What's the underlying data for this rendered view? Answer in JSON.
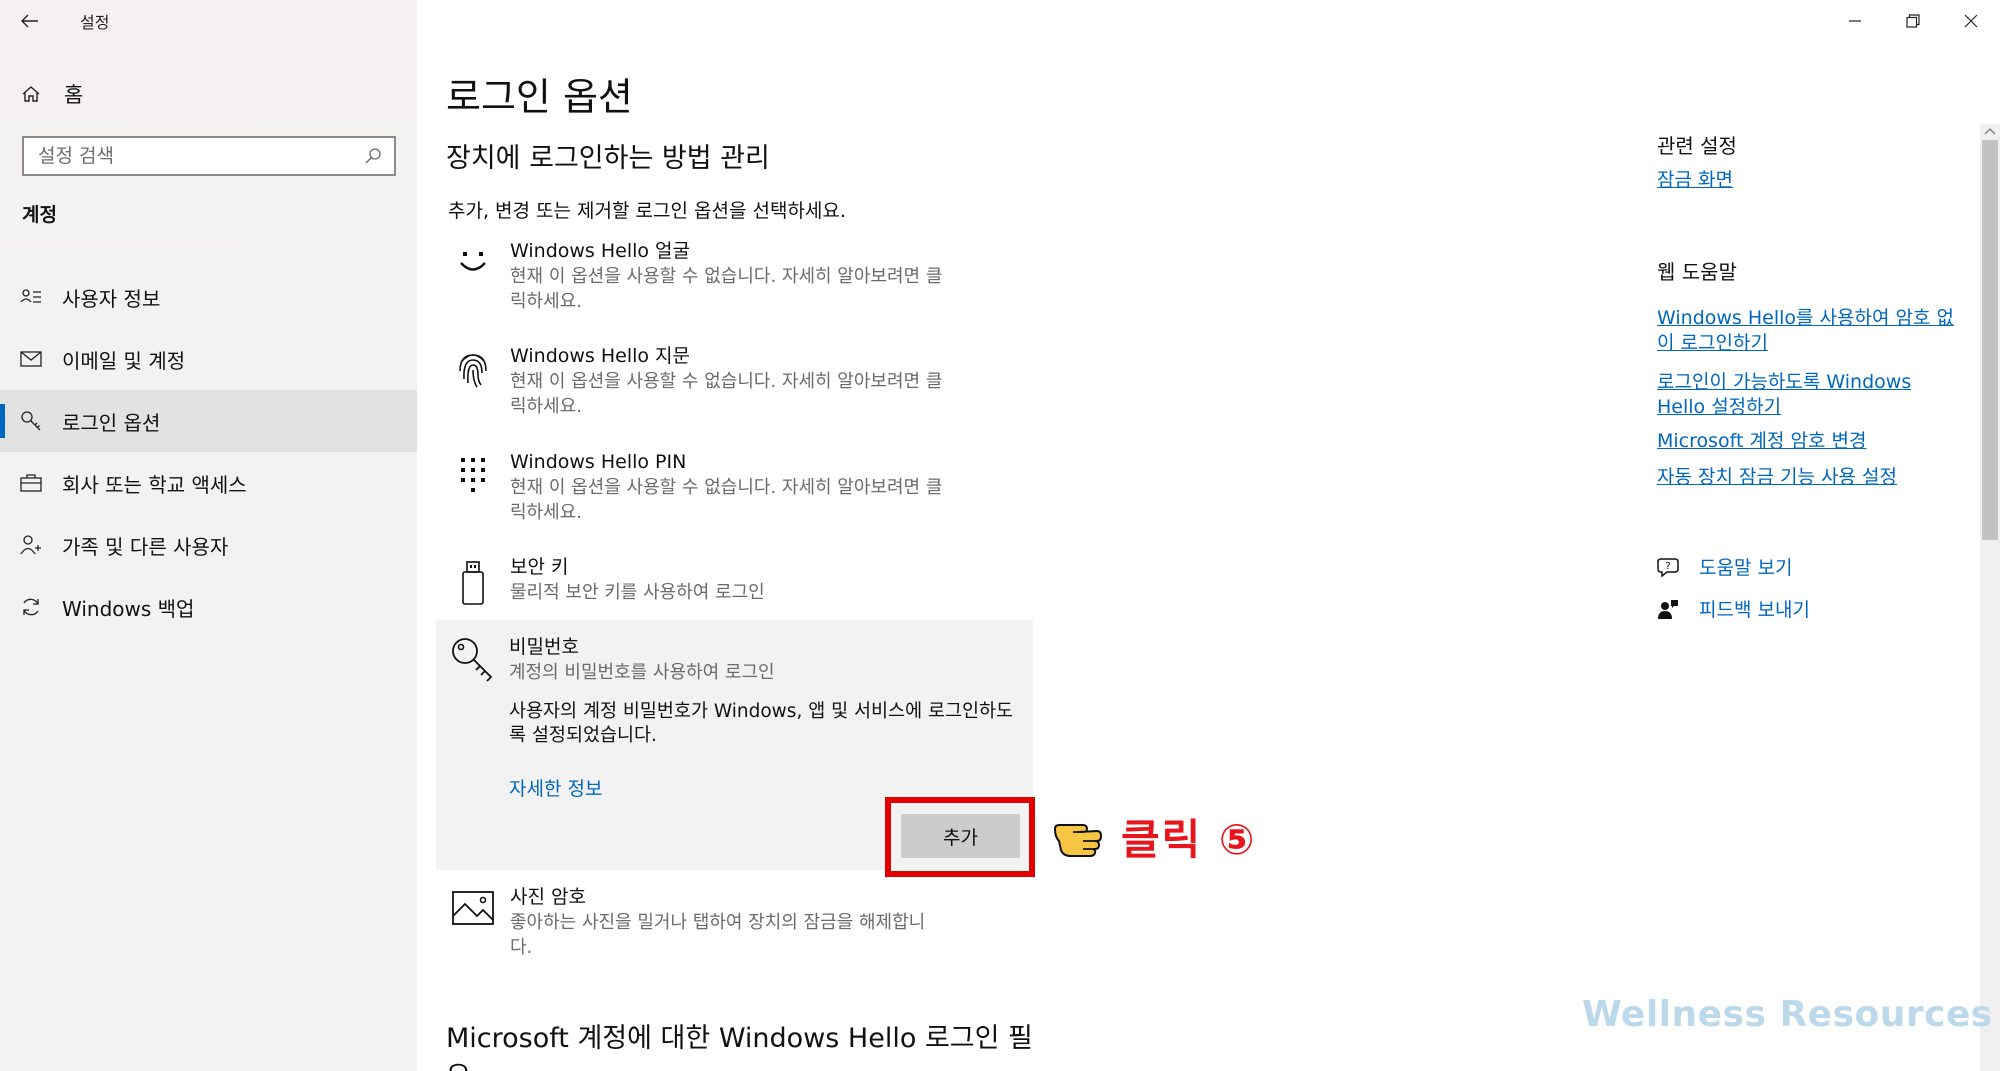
{
  "window": {
    "app_title": "설정",
    "controls": [
      "minimize",
      "restore",
      "close"
    ]
  },
  "sidebar": {
    "home_label": "홈",
    "search_placeholder": "설정 검색",
    "section_heading": "계정",
    "items": [
      {
        "label": "사용자 정보",
        "icon": "person-list-icon"
      },
      {
        "label": "이메일 및 계정",
        "icon": "mail-icon"
      },
      {
        "label": "로그인 옵션",
        "icon": "key-icon",
        "selected": true
      },
      {
        "label": "회사 또는 학교 액세스",
        "icon": "briefcase-icon"
      },
      {
        "label": "가족 및 다른 사용자",
        "icon": "person-add-icon"
      },
      {
        "label": "Windows 백업",
        "icon": "sync-icon"
      }
    ]
  },
  "main": {
    "page_title": "로그인 옵션",
    "sub_heading": "장치에 로그인하는 방법 관리",
    "intro": "추가, 변경 또는 제거할 로그인 옵션을 선택하세요.",
    "options": [
      {
        "title": "Windows Hello 얼굴",
        "desc_line1": "현재 이 옵션을 사용할 수 없습니다. 자세히 알아보려면 클",
        "desc_line2": "릭하세요.",
        "icon": "smile-face-icon"
      },
      {
        "title": "Windows Hello 지문",
        "desc_line1": "현재 이 옵션을 사용할 수 없습니다. 자세히 알아보려면 클",
        "desc_line2": "릭하세요.",
        "icon": "fingerprint-icon"
      },
      {
        "title": "Windows Hello PIN",
        "desc_line1": "현재 이 옵션을 사용할 수 없습니다. 자세히 알아보려면 클",
        "desc_line2": "릭하세요.",
        "icon": "pin-keypad-icon"
      },
      {
        "title": "보안 키",
        "desc_line1": "물리적 보안 키를 사용하여 로그인",
        "icon": "usb-key-icon"
      }
    ],
    "password": {
      "title": "비밀번호",
      "desc": "계정의 비밀번호를 사용하여 로그인",
      "detail": "사용자의 계정 비밀번호가 Windows, 앱 및 서비스에 로그인하도록 설정되었습니다.",
      "link": "자세한 정보",
      "add_button": "추가"
    },
    "picture_password": {
      "title": "사진 암호",
      "desc_line1": "좋아하는 사진을 밀거나 탭하여 장치의 잠금을 해제합니",
      "desc_line2": "다."
    },
    "bottom_heading": "Microsoft 계정에 대한 Windows Hello 로그인 필요"
  },
  "annotation": {
    "click_text": "클릭 ⑤",
    "highlight_color": "#e00000"
  },
  "right": {
    "related_heading": "관련 설정",
    "related_link": "잠금 화면",
    "web_help_heading": "웹 도움말",
    "web_links": [
      {
        "line1": "Windows Hello를 사용하여 암호 없",
        "line2": "이 로그인하기"
      },
      {
        "line1": "로그인이 가능하도록 Windows",
        "line2": "Hello 설정하기"
      },
      {
        "line1": "Microsoft 계정 암호 변경",
        "line2": ""
      },
      {
        "line1": "자동 장치 잠금 기능 사용 설정",
        "line2": ""
      }
    ],
    "help_action": "도움말 보기",
    "feedback_action": "피드백 보내기"
  },
  "watermark": "Wellness Resources",
  "colors": {
    "accent": "#0067c0",
    "sidebar_bg": "#f2f2f2",
    "selected_bg": "#e2e2e2",
    "annotation_red": "#e8161c"
  }
}
